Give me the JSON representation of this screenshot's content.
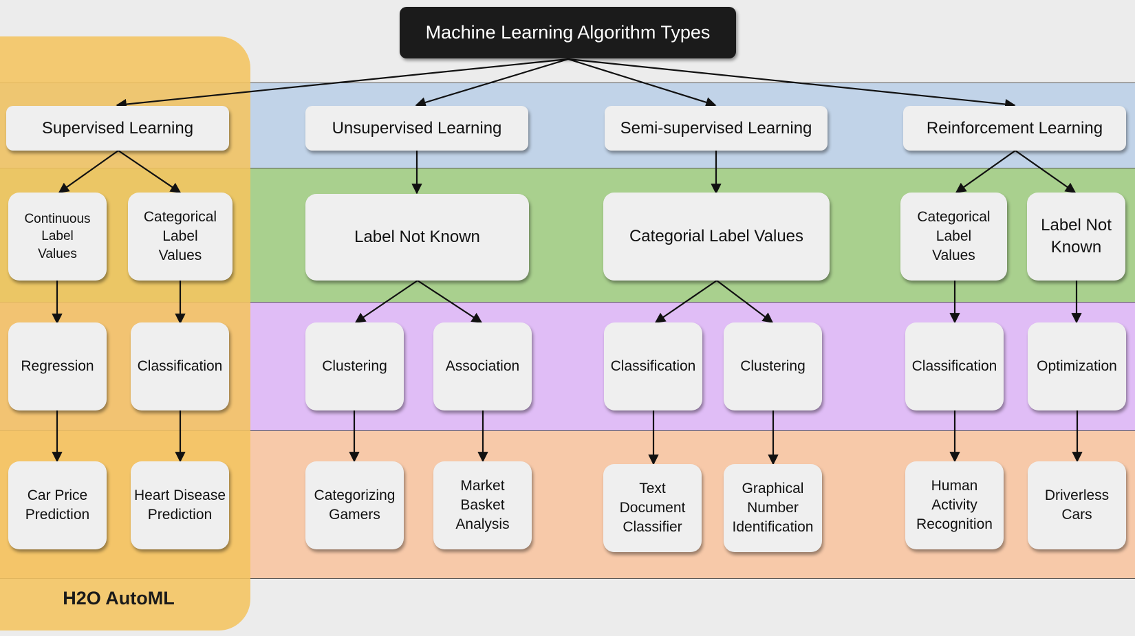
{
  "title": "Machine Learning Algorithm Types",
  "automl_label": "H2O AutoML",
  "categories": {
    "supervised": "Supervised Learning",
    "unsupervised": "Unsupervised Learning",
    "semi_supervised": "Semi-supervised Learning",
    "reinforcement": "Reinforcement Learning"
  },
  "labels": {
    "sup_continuous": "Continuous\nLabel\nValues",
    "sup_categorical": "Categorical\nLabel\nValues",
    "unsup_label": "Label Not Known",
    "semi_label": "Categorial Label Values",
    "rl_categorical": "Categorical\nLabel\nValues",
    "rl_label": "Label Not\nKnown"
  },
  "tasks": {
    "sup_regression": "Regression",
    "sup_classification": "Classification",
    "unsup_clustering": "Clustering",
    "unsup_association": "Association",
    "semi_classification": "Classification",
    "semi_clustering": "Clustering",
    "rl_classification": "Classification",
    "rl_optimization": "Optimization"
  },
  "examples": {
    "sup_car_price": "Car Price\nPrediction",
    "sup_heart_disease": "Heart Disease\nPrediction",
    "unsup_gamers": "Categorizing\nGamers",
    "unsup_market_basket": "Market\nBasket\nAnalysis",
    "semi_text_doc": "Text\nDocument\nClassifier",
    "semi_graphical_number": "Graphical\nNumber\nIdentification",
    "rl_human_activity": "Human\nActivity\nRecognition",
    "rl_driverless": "Driverless\nCars"
  },
  "colors": {
    "band_categories": "#c1d3e8",
    "band_labels": "#a9d08e",
    "band_tasks": "#e0bdf6",
    "band_examples": "#f7c9a9",
    "automl_highlight": "#f4c460",
    "title_box": "#1b1b1b",
    "node_fill": "#efefef"
  }
}
